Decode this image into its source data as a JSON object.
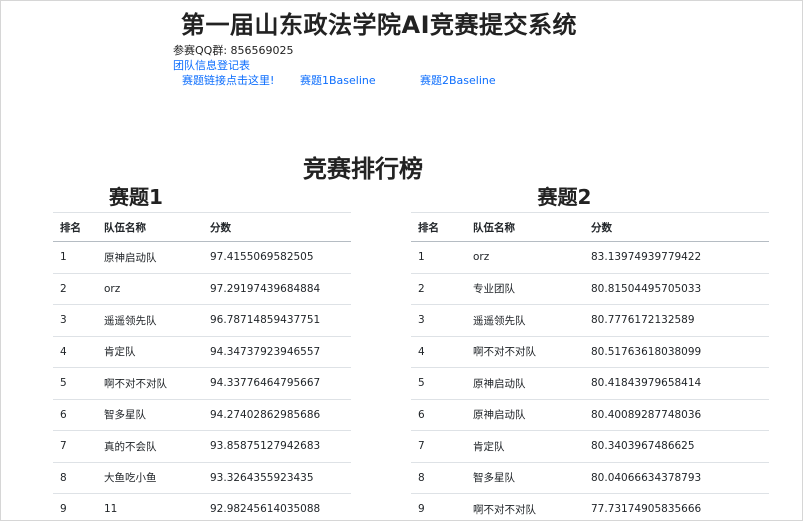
{
  "header": {
    "title": "第一届山东政法学院AI竞赛提交系统",
    "qq_label": "参赛QQ群: 856569025",
    "team_form_link": "团队信息登记表",
    "competition_link": "赛题链接点击这里!",
    "baseline1_link": "赛题1Baseline",
    "baseline2_link": "赛题2Baseline"
  },
  "leaderboard": {
    "title": "竞赛排行榜",
    "columns": [
      "排名",
      "队伍名称",
      "分数"
    ],
    "task1": {
      "title": "赛题1",
      "rows": [
        {
          "rank": "1",
          "team": "原神启动队",
          "score": "97.4155069582505"
        },
        {
          "rank": "2",
          "team": "orz",
          "score": "97.29197439684884"
        },
        {
          "rank": "3",
          "team": "遥遥领先队",
          "score": "96.78714859437751"
        },
        {
          "rank": "4",
          "team": "肯定队",
          "score": "94.34737923946557"
        },
        {
          "rank": "5",
          "team": "啊不对不对队",
          "score": "94.33776464795667"
        },
        {
          "rank": "6",
          "team": "智多星队",
          "score": "94.27402862985686"
        },
        {
          "rank": "7",
          "team": "真的不会队",
          "score": "93.85875127942683"
        },
        {
          "rank": "8",
          "team": "大鱼吃小鱼",
          "score": "93.3264355923435"
        },
        {
          "rank": "9",
          "team": "11",
          "score": "92.98245614035088"
        }
      ]
    },
    "task2": {
      "title": "赛题2",
      "rows": [
        {
          "rank": "1",
          "team": "orz",
          "score": "83.13974939779422"
        },
        {
          "rank": "2",
          "team": "专业团队",
          "score": "80.81504495705033"
        },
        {
          "rank": "3",
          "team": "遥遥领先队",
          "score": "80.7776172132589"
        },
        {
          "rank": "4",
          "team": "啊不对不对队",
          "score": "80.51763618038099"
        },
        {
          "rank": "5",
          "team": "原神启动队",
          "score": "80.41843979658414"
        },
        {
          "rank": "6",
          "team": "原神启动队",
          "score": "80.40089287748036"
        },
        {
          "rank": "7",
          "team": "肯定队",
          "score": "80.3403967486625"
        },
        {
          "rank": "8",
          "team": "智多星队",
          "score": "80.04066634378793"
        },
        {
          "rank": "9",
          "team": "啊不对不对队",
          "score": "77.73174905835666"
        }
      ]
    }
  },
  "colors": {
    "link": "#0d6efd",
    "text": "#212529",
    "border": "#dee2e6"
  }
}
